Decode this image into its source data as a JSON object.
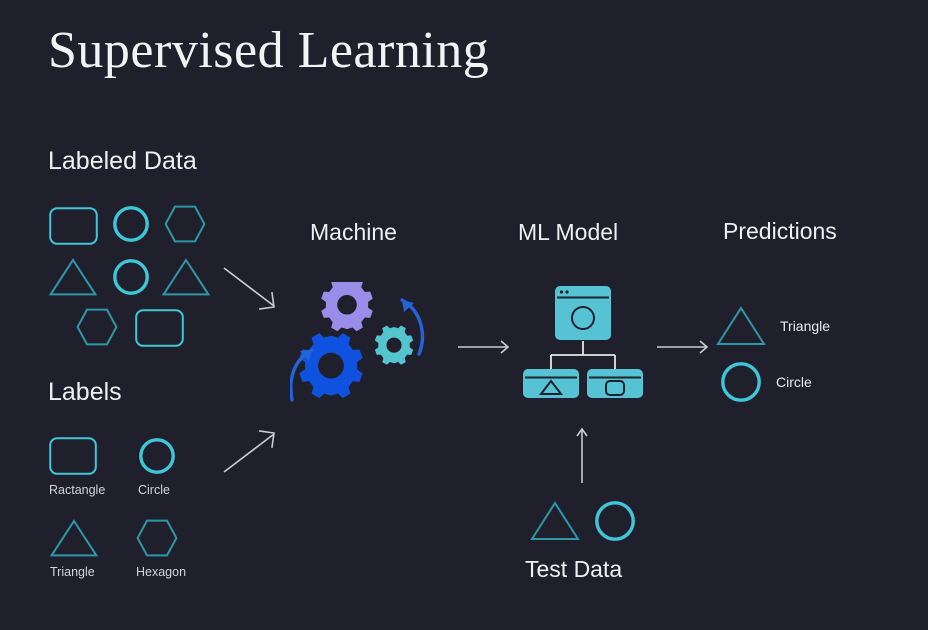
{
  "page": {
    "title": "Supervised Learning",
    "background_color": "#20202c"
  },
  "palette": {
    "cyan_bright": "#3fc6d8",
    "cyan_dim": "#2e8fa0",
    "teal_fill": "#55c3d4",
    "gear_purple": "#9b8cea",
    "gear_blue": "#0f52e0",
    "gear_teal": "#54c4cf",
    "arrow_blue": "#2563d8",
    "arrow_gray": "#c9cad2",
    "text_light": "#f0f0f4",
    "text_muted": "#d2d3da"
  },
  "labeled_data": {
    "heading": "Labeled Data",
    "shapes": [
      {
        "name": "rounded-rectangle",
        "emphasis": "dim"
      },
      {
        "name": "circle",
        "emphasis": "bright"
      },
      {
        "name": "hexagon",
        "emphasis": "dim"
      },
      {
        "name": "triangle",
        "emphasis": "dim"
      },
      {
        "name": "circle",
        "emphasis": "bright"
      },
      {
        "name": "triangle",
        "emphasis": "dim"
      },
      {
        "name": "hexagon",
        "emphasis": "dim"
      },
      {
        "name": "rounded-rectangle",
        "emphasis": "dim"
      }
    ]
  },
  "labels": {
    "heading": "Labels",
    "items": [
      {
        "shape": "rounded-rectangle",
        "caption": "Ractangle",
        "emphasis": "dim"
      },
      {
        "shape": "circle",
        "caption": "Circle",
        "emphasis": "bright"
      },
      {
        "shape": "triangle",
        "caption": "Triangle",
        "emphasis": "dim"
      },
      {
        "shape": "hexagon",
        "caption": "Hexagon",
        "emphasis": "dim"
      }
    ]
  },
  "machine": {
    "heading": "Machine",
    "gears": [
      {
        "name": "gear-purple",
        "color": "#9b8cea"
      },
      {
        "name": "gear-blue",
        "color": "#0f52e0"
      },
      {
        "name": "gear-teal",
        "color": "#54c4cf"
      }
    ],
    "rotation_arrows": 2
  },
  "ml_model": {
    "heading": "ML Model",
    "root_node": {
      "icon": "circle",
      "has_titlebar_dots": true
    },
    "child_nodes": [
      {
        "icon": "triangle"
      },
      {
        "icon": "rounded-square"
      }
    ]
  },
  "predictions": {
    "heading": "Predictions",
    "items": [
      {
        "shape": "triangle",
        "caption": "Triangle",
        "emphasis": "dim"
      },
      {
        "shape": "circle",
        "caption": "Circle",
        "emphasis": "bright"
      }
    ]
  },
  "test_data": {
    "label": "Test Data",
    "shapes": [
      {
        "name": "triangle",
        "emphasis": "dim"
      },
      {
        "name": "circle",
        "emphasis": "bright"
      }
    ]
  },
  "flow_arrows": [
    {
      "name": "labeled-data-to-machine",
      "direction": "down-right"
    },
    {
      "name": "labels-to-machine",
      "direction": "up-right"
    },
    {
      "name": "machine-to-ml-model",
      "direction": "right"
    },
    {
      "name": "ml-model-to-predictions",
      "direction": "right"
    },
    {
      "name": "test-data-to-ml-model",
      "direction": "up"
    }
  ]
}
